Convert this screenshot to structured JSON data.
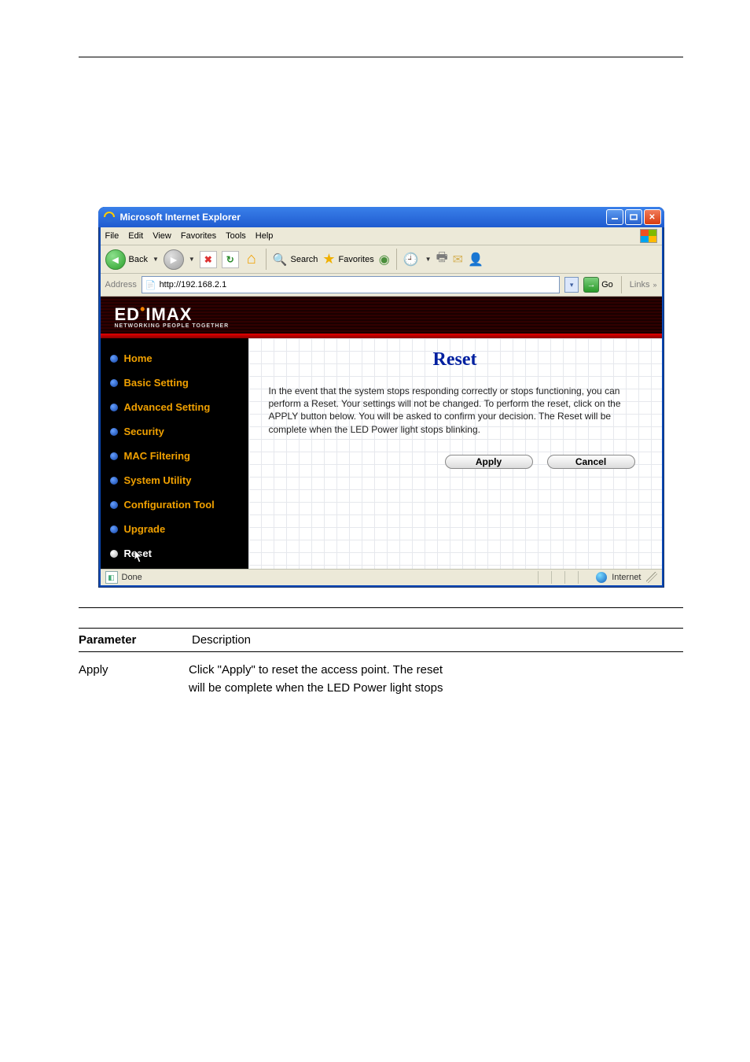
{
  "titlebar": {
    "title": "Microsoft Internet Explorer"
  },
  "menu": {
    "file": "File",
    "edit": "Edit",
    "view": "View",
    "favorites": "Favorites",
    "tools": "Tools",
    "help": "Help"
  },
  "toolbar": {
    "back": "Back",
    "search": "Search",
    "favorites": "Favorites"
  },
  "addressbar": {
    "label": "Address",
    "url": "http://192.168.2.1",
    "go": "Go",
    "links": "Links"
  },
  "brand": {
    "name": "EDIMAX",
    "tagline": "NETWORKING PEOPLE TOGETHER"
  },
  "sidebar": {
    "items": [
      {
        "label": "Home",
        "active": false
      },
      {
        "label": "Basic Setting",
        "active": false
      },
      {
        "label": "Advanced Setting",
        "active": false
      },
      {
        "label": "Security",
        "active": false
      },
      {
        "label": "MAC Filtering",
        "active": false
      },
      {
        "label": "System Utility",
        "active": false
      },
      {
        "label": "Configuration Tool",
        "active": false
      },
      {
        "label": "Upgrade",
        "active": false
      },
      {
        "label": "Reset",
        "active": true
      }
    ]
  },
  "main": {
    "heading": "Reset",
    "body": "In the event that the system stops responding correctly or stops functioning, you can perform a Reset. Your settings will not be changed. To perform the reset, click on the APPLY button below. You will be asked to confirm your decision. The Reset will be complete when the LED Power light stops blinking.",
    "apply": "Apply",
    "cancel": "Cancel"
  },
  "statusbar": {
    "done": "Done",
    "zone": "Internet"
  },
  "doc": {
    "param": "Parameter",
    "desc": "Description",
    "apply_label": "Apply",
    "apply_desc": "Click \"Apply\" to reset the access point. The reset",
    "apply_desc2": "will be complete when the LED Power light stops"
  }
}
